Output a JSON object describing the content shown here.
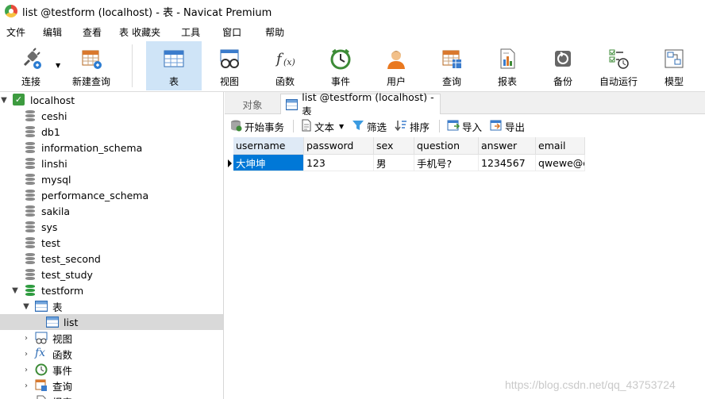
{
  "window": {
    "title": "list @testform (localhost) - 表 - Navicat Premium"
  },
  "menu": [
    "文件",
    "编辑",
    "查看",
    "表",
    "收藏夹",
    "工具",
    "窗口",
    "帮助"
  ],
  "toolbar": {
    "connect": "连接",
    "new_query": "新建查询",
    "table": "表",
    "view": "视图",
    "function": "函数",
    "event": "事件",
    "user": "用户",
    "query": "查询",
    "report": "报表",
    "backup": "备份",
    "auto_run": "自动运行",
    "model": "模型"
  },
  "tree": {
    "connection": "localhost",
    "databases": [
      "ceshi",
      "db1",
      "information_schema",
      "linshi",
      "mysql",
      "performance_schema",
      "sakila",
      "sys",
      "test",
      "test_second",
      "test_study"
    ],
    "open_db": "testform",
    "tables_group": "表",
    "selected_table": "list",
    "groups": [
      "视图",
      "函数",
      "事件",
      "查询",
      "报表"
    ]
  },
  "tabs": {
    "objects": "对象",
    "current": "list @testform (localhost) - 表"
  },
  "subtoolbar": {
    "begin_transaction": "开始事务",
    "text": "文本",
    "filter": "筛选",
    "sort": "排序",
    "import": "导入",
    "export": "导出"
  },
  "grid": {
    "columns": [
      "username",
      "password",
      "sex",
      "question",
      "answer",
      "email"
    ],
    "rows": [
      [
        "大坤坤",
        "123",
        "男",
        "手机号?",
        "1234567",
        "qwewe@q"
      ]
    ]
  },
  "watermark": "https://blog.csdn.net/qq_43753724"
}
